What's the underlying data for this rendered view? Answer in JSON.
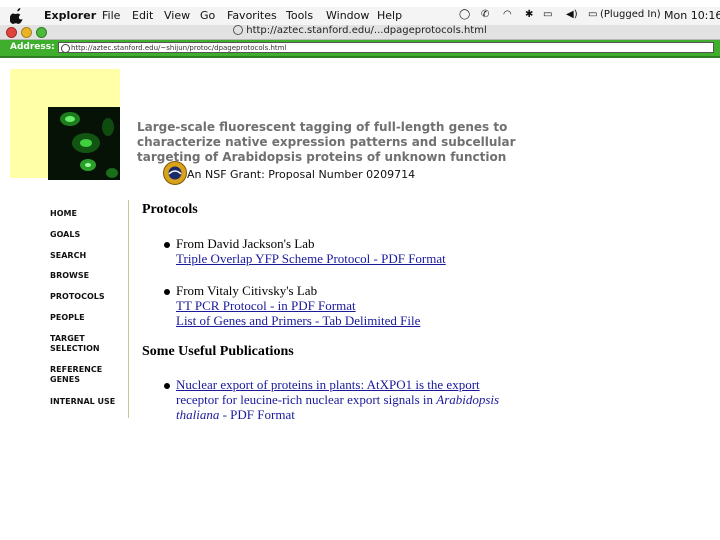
{
  "menubar": {
    "app": "Explorer",
    "items": [
      "File",
      "Edit",
      "View",
      "Go",
      "Favorites",
      "Tools",
      "Window",
      "Help"
    ],
    "status": "(Plugged In)",
    "clock": "Mon 10:16"
  },
  "window": {
    "title": "http://aztec.stanford.edu/...dpageprotocols.html"
  },
  "address": {
    "label": "Address:",
    "url": "http://aztec.stanford.edu/~shijun/protoc/dpageprotocols.html"
  },
  "page": {
    "headline": "Large-scale fluorescent tagging of full-length genes to characterize native expression patterns and subcellular targeting of Arabidopsis proteins of unknown function",
    "grant": "An NSF Grant: Proposal Number 0209714",
    "nav": [
      "HOME",
      "GOALS",
      "SEARCH",
      "BROWSE",
      "PROTOCOLS",
      "PEOPLE",
      "TARGET SELECTION",
      "REFERENCE GENES",
      "INTERNAL USE"
    ],
    "protocols_heading": "Protocols",
    "lab1": "From David Jackson's Lab",
    "lab1_link": "Triple Overlap YFP Scheme Protocol - PDF Format",
    "lab2": "From Vitaly Citivsky's Lab",
    "lab2_link1": "TT PCR Protocol - in PDF Format",
    "lab2_link2": "List of Genes and Primers - Tab Delimited File",
    "pubs_heading": "Some Useful Publications",
    "pub1_line1": "Nuclear export of proteins in plants: AtXPO1 is the export",
    "pub1_line2_a": "receptor for leucine-rich nuclear export signals in ",
    "pub1_line2_b": "Arabidopsis",
    "pub1_line3_a": "thaliana",
    "pub1_line3_b": " - PDF Format"
  },
  "colors": {
    "address_bar": "#3fae2d",
    "yellow": "#ffffa8",
    "link": "#1a1a9c",
    "headline": "#707070"
  }
}
